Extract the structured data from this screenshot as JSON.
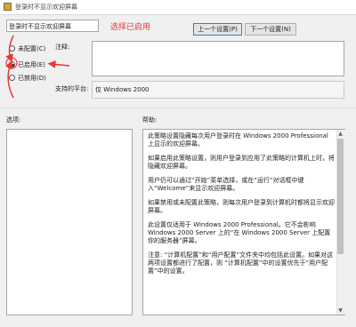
{
  "window": {
    "title": "登录时不显示欢迎屏幕",
    "setting_label": "登录时不显示欢迎屏幕"
  },
  "annotation": {
    "text": "选择已启用",
    "color": "#e53935"
  },
  "buttons": {
    "prev": "上一个设置(P)",
    "next": "下一个设置(N)"
  },
  "state": {
    "options": [
      {
        "label": "未配置(C)",
        "selected": false
      },
      {
        "label": "已启用(E)",
        "selected": true
      },
      {
        "label": "已禁用(D)",
        "selected": false
      }
    ]
  },
  "fields": {
    "comment_label": "注释:",
    "platform_label": "支持的平台:",
    "platform_value": "仅 Windows 2000",
    "options_label": "选项:",
    "help_label": "帮助:"
  },
  "help": {
    "paragraphs": [
      "此策略设置隐藏每次用户登录时在 Windows 2000 Professional 上显示的欢迎屏幕。",
      "如果启用此策略设置，则用户登录到应用了此策略的计算机上时，将隐藏欢迎屏幕。",
      "用户仍可以通过“开始”菜单选择，或在“运行”对话框中键入“Welcome”来显示欢迎屏幕。",
      "如果禁用或未配置此策略，则每次用户登录到计算机时都将显示欢迎屏幕。",
      "此设置仅适用于 Windows 2000 Professional。它不会影响 Windows 2000 Server 上的“在 Windows 2000 Server 上配置你的服务器”屏幕。",
      "注意: “计算机配置”和“用户配置”文件夹中均包括此设置。如果对这两项设置都进行了配置，则 “计算机配置”中的设置优先于“用户配置”中的设置。"
    ]
  }
}
